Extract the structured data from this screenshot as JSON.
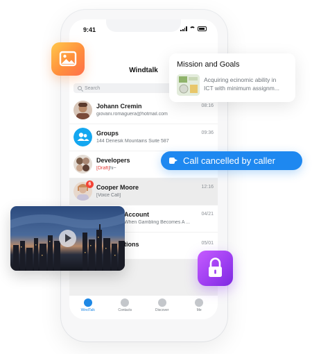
{
  "status_bar": {
    "time": "9:41"
  },
  "app": {
    "title": "Windtalk"
  },
  "search": {
    "placeholder": "Search"
  },
  "conversations": [
    {
      "name": "Johann Cremin",
      "message": "giovani.romaguera@hotmail.com",
      "time": "08:16",
      "draft_tag": "",
      "badge": ""
    },
    {
      "name": "Groups",
      "message": "144 Denesik Mountains Suite 587",
      "time": "09:36",
      "draft_tag": "",
      "badge": ""
    },
    {
      "name": "Developers",
      "message": "hi~",
      "time": "",
      "draft_tag": "[Draft]",
      "badge": ""
    },
    {
      "name": "Cooper Moore",
      "message": "[Voice Call]",
      "time": "12:16",
      "draft_tag": "",
      "badge": "6"
    },
    {
      "name": "Account",
      "message": "When Gambling Becomes A ...",
      "time": "04/21",
      "draft_tag": "",
      "badge": ""
    },
    {
      "name": "tions",
      "message": "",
      "time": "05/01",
      "draft_tag": "",
      "badge": ""
    }
  ],
  "tabs": [
    {
      "label": "WindTalk",
      "icon": "chat-icon",
      "active": true
    },
    {
      "label": "Contacts",
      "icon": "contacts-icon",
      "active": false
    },
    {
      "label": "Discover",
      "icon": "compass-icon",
      "active": false
    },
    {
      "label": "Me",
      "icon": "person-icon",
      "active": false
    }
  ],
  "mission_card": {
    "title": "Mission and Goals",
    "line1": "Acquiring ecinomic ability in",
    "line2": "ICT with minimum assignm..."
  },
  "call_notice": {
    "text": "Call cancelled by caller",
    "icon": "video-camera-icon"
  },
  "colors": {
    "accent_blue": "#1e88f0",
    "photo_gradient": "#ff8f3c",
    "lock_gradient": "#9b3cf0",
    "badge_red": "#f44336",
    "draft_red": "#e53935"
  }
}
